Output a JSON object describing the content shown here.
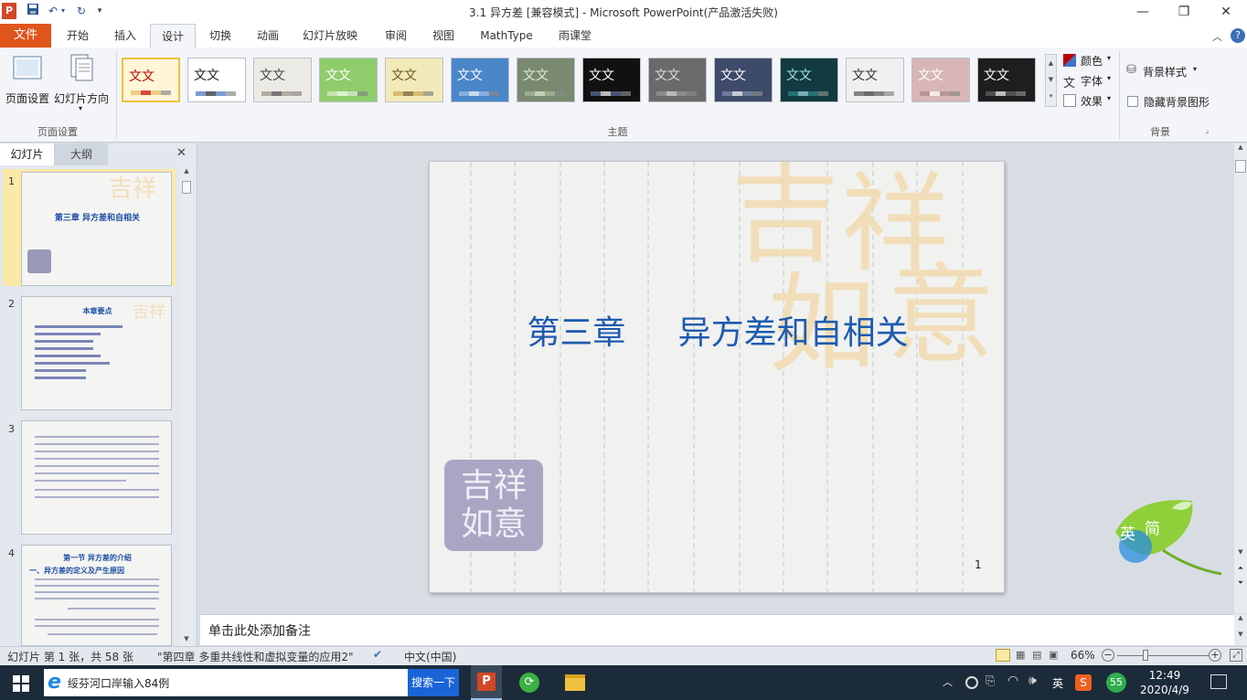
{
  "app": {
    "title": "3.1 异方差 [兼容模式] - Microsoft PowerPoint(产品激活失败)"
  },
  "window_controls": {
    "minimize": "—",
    "restore": "❐",
    "close": "✕"
  },
  "tabs": [
    "文件",
    "开始",
    "插入",
    "设计",
    "切换",
    "动画",
    "幻灯片放映",
    "审阅",
    "视图",
    "MathType",
    "雨课堂"
  ],
  "active_tab": "设计",
  "ribbon": {
    "page_setup": {
      "btn1": "页面设置",
      "btn2": "幻灯片方向",
      "group": "页面设置"
    },
    "themes": {
      "group": "主题",
      "sample": "文文",
      "items": [
        {
          "bg": "#ffffff",
          "fg": "#c00000",
          "accent": "#e5c060"
        },
        {
          "bg": "#ffffff",
          "fg": "#222222",
          "accent": "#4472c4"
        },
        {
          "bg": "#eceae4",
          "fg": "#444444",
          "accent": "#999080"
        },
        {
          "bg": "#8fcc6b",
          "fg": "#ffffff",
          "accent": "#e0ecd0"
        },
        {
          "bg": "#f3eaba",
          "fg": "#6a5a20",
          "accent": "#c8a850"
        },
        {
          "bg": "#4a86c8",
          "fg": "#ffffff",
          "accent": "#9cc0e6"
        },
        {
          "bg": "#7a8a70",
          "fg": "#e6eadc",
          "accent": "#aab89a"
        },
        {
          "bg": "#111111",
          "fg": "#ffffff",
          "accent": "#6070a0"
        },
        {
          "bg": "#6a6a6a",
          "fg": "#dddddd",
          "accent": "#999999"
        },
        {
          "bg": "#3e4a6a",
          "fg": "#ffffff",
          "accent": "#8090b0"
        },
        {
          "bg": "#123a40",
          "fg": "#9fe0e0",
          "accent": "#2a8a8a"
        },
        {
          "bg": "#f0f0f0",
          "fg": "#333333",
          "accent": "#555555"
        },
        {
          "bg": "#d8b6b6",
          "fg": "#ffffff",
          "accent": "#a88"
        },
        {
          "bg": "#1e1e1e",
          "fg": "#ffffff",
          "accent": "#666"
        }
      ]
    },
    "colors": "颜色",
    "fonts": "字体",
    "effects": "效果",
    "bg_styles": "背景样式",
    "hide_bg": "隐藏背景图形",
    "bg_group": "背景"
  },
  "pane": {
    "tab_slides": "幻灯片",
    "tab_outline": "大纲",
    "close": "✕"
  },
  "thumbnails": [
    {
      "num": "1",
      "title": "第三章   异方差和自相关"
    },
    {
      "num": "2",
      "title": "本章要点"
    },
    {
      "num": "3",
      "title": ""
    },
    {
      "num": "4",
      "title": "第一节 异方差的介绍",
      "subtitle": "一、异方差的定义及产生原因"
    }
  ],
  "slide": {
    "title": "第三章     异方差和自相关",
    "page": "1",
    "seal_text": "吉祥如意"
  },
  "notes": {
    "placeholder": "单击此处添加备注"
  },
  "status": {
    "slide_info": "幻灯片 第 1 张，共 58 张",
    "theme": "\"第四章 多重共线性和虚拟变量的应用2\"",
    "language": "中文(中国)",
    "zoom": "66%"
  },
  "ime": {
    "a": "英",
    "b": "简"
  },
  "taskbar": {
    "search_text": "绥芬河口岸输入84例",
    "search_button": "搜索一下",
    "tray_lang": "英",
    "badge": "55",
    "time": "12:49",
    "date": "2020/4/9"
  }
}
